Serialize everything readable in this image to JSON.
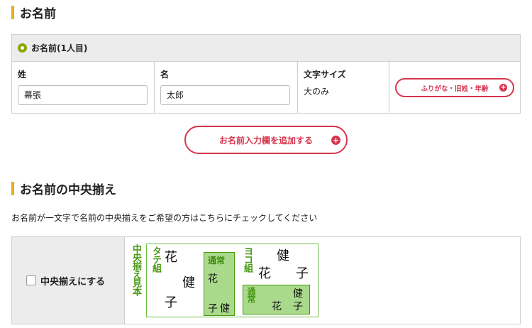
{
  "section1": {
    "title": "お名前"
  },
  "name_block": {
    "header_label": "お名前(1人目)",
    "last_name": {
      "label": "姓",
      "value": "幕張"
    },
    "first_name": {
      "label": "名",
      "value": "太郎"
    },
    "font_size": {
      "label": "文字サイズ",
      "value": "大のみ"
    },
    "options_button": "ふりがな・旧姓・年齢",
    "add_button": "お名前入力欄を追加する"
  },
  "section2": {
    "title": "お名前の中央揃え",
    "description": "お名前が一文字で名前の中央揃えをご希望の方はこちらにチェックしてください",
    "checkbox_label": "中央揃えにする",
    "sample": {
      "side_label": "中央揃え見本",
      "vertical_label": "タテ組",
      "horizontal_label": "ヨコ組",
      "normal_label": "通常",
      "glyph_hana": "花",
      "glyph_ken": "健",
      "glyph_ko": "子"
    }
  },
  "colors": {
    "accent_yellow": "#e9ad1b",
    "button_red": "#d5354d",
    "sample_green": "#4a9a14",
    "radio_green": "#8fa400"
  },
  "icons": {
    "plus": "plus-circle-icon",
    "radio": "radio-selected-icon"
  }
}
